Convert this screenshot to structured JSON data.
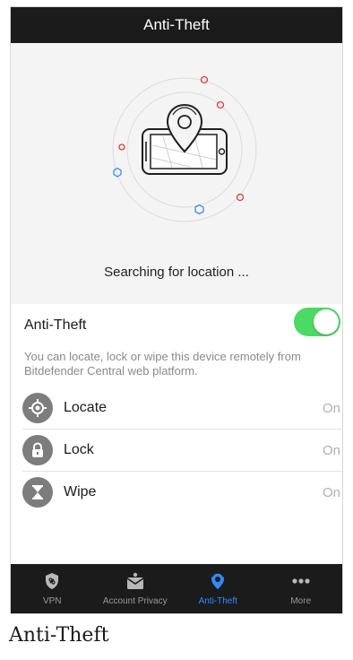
{
  "header": {
    "title": "Anti-Theft"
  },
  "hero": {
    "status_text": "Searching for location ...",
    "illustration": "phone-with-location-pin-icon"
  },
  "settings": {
    "title": "Anti-Theft",
    "toggle_on": true,
    "description": "You can locate, lock or wipe this device remotely from Bitdefender Central web platform."
  },
  "features": [
    {
      "label": "Locate",
      "status": "On",
      "icon": "target-icon"
    },
    {
      "label": "Lock",
      "status": "On",
      "icon": "lock-icon"
    },
    {
      "label": "Wipe",
      "status": "On",
      "icon": "hourglass-icon"
    }
  ],
  "tabs": [
    {
      "label": "VPN",
      "icon": "shield-icon",
      "active": false
    },
    {
      "label": "Account Privacy",
      "icon": "envelope-icon",
      "active": false
    },
    {
      "label": "Anti-Theft",
      "icon": "location-pin-icon",
      "active": true
    },
    {
      "label": "More",
      "icon": "ellipsis-icon",
      "active": false
    }
  ],
  "caption": "Anti-Theft",
  "colors": {
    "accent_blue": "#2f8bff",
    "toggle_green": "#4cd964",
    "dark_bar": "#1b1b1b",
    "hero_bg": "#f4f4f4",
    "ring_red": "#e03a3a",
    "ring_blue": "#3d8ee6"
  }
}
